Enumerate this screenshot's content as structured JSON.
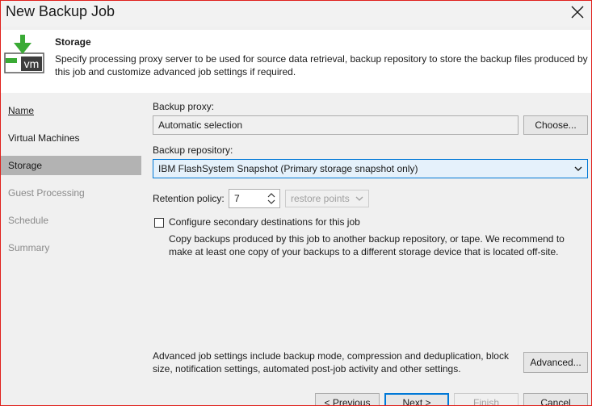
{
  "window": {
    "title": "New Backup Job"
  },
  "header": {
    "icon_text": "vm",
    "title": "Storage",
    "description": "Specify processing proxy server to be used for source data retrieval, backup repository to store the backup files produced by this job and customize advanced job settings if required."
  },
  "sidebar": {
    "items": [
      {
        "label": "Name",
        "state": "link"
      },
      {
        "label": "Virtual Machines",
        "state": "normal"
      },
      {
        "label": "Storage",
        "state": "active"
      },
      {
        "label": "Guest Processing",
        "state": "disabled"
      },
      {
        "label": "Schedule",
        "state": "disabled"
      },
      {
        "label": "Summary",
        "state": "disabled"
      }
    ]
  },
  "main": {
    "proxy_label": "Backup proxy:",
    "proxy_value": "Automatic selection",
    "choose_button": "Choose...",
    "repository_label": "Backup repository:",
    "repository_value": "IBM FlashSystem Snapshot (Primary storage snapshot only)",
    "retention_label": "Retention policy:",
    "retention_value": "7",
    "retention_unit": "restore points",
    "secondary_checkbox_label": "Configure secondary destinations for this job",
    "secondary_checked": false,
    "secondary_help": "Copy backups produced by this job to another backup repository, or tape. We recommend to make at least one copy of your backups to a different storage device that is located off-site.",
    "advanced_text": "Advanced job settings include backup mode, compression and deduplication, block size, notification settings, automated post-job activity and other settings.",
    "advanced_button": "Advanced..."
  },
  "footer": {
    "previous": "< Previous",
    "next": "Next >",
    "finish": "Finish",
    "cancel": "Cancel"
  },
  "colors": {
    "accent": "#0078d7",
    "frame_border": "#e0201c",
    "active_nav": "#b3b3b3",
    "icon_green": "#3aaa35"
  },
  "icons": {
    "close": "close-icon",
    "vm": "vm-download-icon",
    "dropdown": "chevron-down-icon",
    "spinner": "spinner-arrows-icon"
  }
}
